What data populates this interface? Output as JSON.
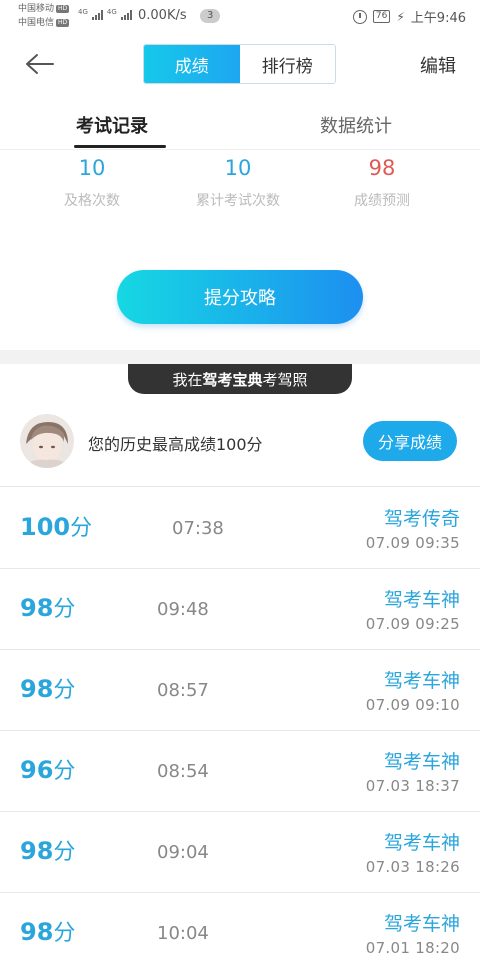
{
  "status_bar": {
    "carrier_1": "中国移动",
    "carrier_2": "中国电信",
    "hd_badge": "HD",
    "signal_4g": "4G",
    "net_speed": "0.00K/s",
    "notification_count": "3",
    "battery": "76",
    "time": "上午9:46"
  },
  "header": {
    "segments": [
      "成绩",
      "排行榜"
    ],
    "edit_label": "编辑"
  },
  "tabs": {
    "active": "考试记录",
    "inactive": "数据统计"
  },
  "stats": [
    {
      "value": "10",
      "label": "及格次数"
    },
    {
      "value": "10",
      "label": "累计考试次数"
    },
    {
      "value": "98",
      "label": "成绩预测"
    }
  ],
  "tip_button_label": "提分攻略",
  "banner": {
    "prefix": "我在",
    "brand": "驾考宝典",
    "suffix": "考驾照"
  },
  "best": {
    "text": "您的历史最高成绩100分",
    "share_label": "分享成绩"
  },
  "colors": {
    "accent": "#2ba6dc",
    "prediction": "#e05a55"
  },
  "records": [
    {
      "score": "100",
      "unit": "分",
      "duration": "07:38",
      "title": "驾考传奇",
      "date": "07.09",
      "time": "09:35"
    },
    {
      "score": "98",
      "unit": "分",
      "duration": "09:48",
      "title": "驾考车神",
      "date": "07.09",
      "time": "09:25"
    },
    {
      "score": "98",
      "unit": "分",
      "duration": "08:57",
      "title": "驾考车神",
      "date": "07.09",
      "time": "09:10"
    },
    {
      "score": "96",
      "unit": "分",
      "duration": "08:54",
      "title": "驾考车神",
      "date": "07.03",
      "time": "18:37"
    },
    {
      "score": "98",
      "unit": "分",
      "duration": "09:04",
      "title": "驾考车神",
      "date": "07.03",
      "time": "18:26"
    },
    {
      "score": "98",
      "unit": "分",
      "duration": "10:04",
      "title": "驾考车神",
      "date": "07.01",
      "time": "18:20"
    }
  ]
}
